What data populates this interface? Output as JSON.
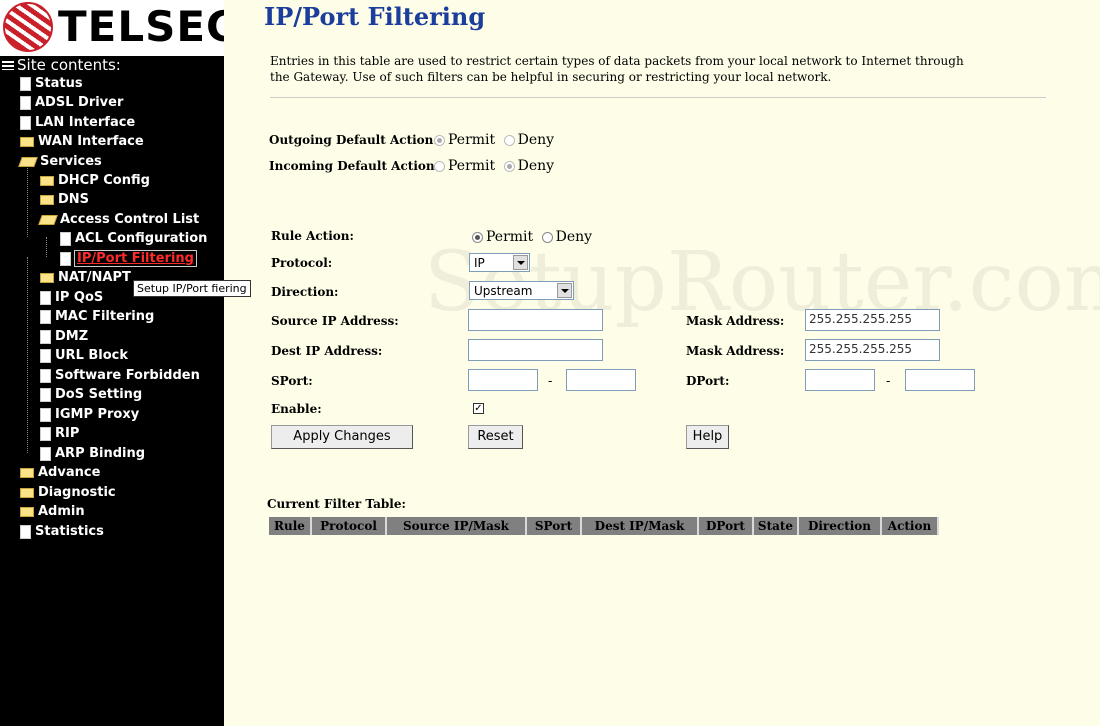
{
  "brand": {
    "logo_text": "TELSEC"
  },
  "sidebar": {
    "heading": "Site contents:",
    "items": [
      {
        "label": "Status",
        "icon": "doc"
      },
      {
        "label": "ADSL Driver",
        "icon": "doc"
      },
      {
        "label": "LAN Interface",
        "icon": "doc"
      },
      {
        "label": "WAN Interface",
        "icon": "folder"
      },
      {
        "label": "Services",
        "icon": "folder-open"
      },
      {
        "label": "DHCP Config",
        "icon": "folder"
      },
      {
        "label": "DNS",
        "icon": "folder"
      },
      {
        "label": "Access Control List",
        "icon": "folder-open"
      },
      {
        "label": "ACL Configuration",
        "icon": "doc"
      },
      {
        "label": "IP/Port Filtering",
        "icon": "doc",
        "selected": true
      },
      {
        "label": "NAT/NAPT",
        "icon": "folder"
      },
      {
        "label": "IP QoS",
        "icon": "doc"
      },
      {
        "label": "MAC Filtering",
        "icon": "doc"
      },
      {
        "label": "DMZ",
        "icon": "doc"
      },
      {
        "label": "URL Block",
        "icon": "doc"
      },
      {
        "label": "Software Forbidden",
        "icon": "doc"
      },
      {
        "label": "DoS Setting",
        "icon": "doc"
      },
      {
        "label": "IGMP Proxy",
        "icon": "doc"
      },
      {
        "label": "RIP",
        "icon": "doc"
      },
      {
        "label": "ARP Binding",
        "icon": "doc"
      },
      {
        "label": "Advance",
        "icon": "folder"
      },
      {
        "label": "Diagnostic",
        "icon": "folder"
      },
      {
        "label": "Admin",
        "icon": "folder"
      },
      {
        "label": "Statistics",
        "icon": "doc"
      }
    ],
    "tooltip": "Setup IP/Port fiering"
  },
  "page": {
    "title": "IP/Port Filtering",
    "description": "Entries in this table are used to restrict certain types of data packets from your local network to Internet through the Gateway. Use of such filters can be helpful in securing or restricting your local network."
  },
  "defaults": {
    "outgoing_label": "Outgoing Default Action:",
    "incoming_label": "Incoming Default Action:",
    "permit": "Permit",
    "deny": "Deny",
    "outgoing_value": "Permit",
    "incoming_value": "Deny"
  },
  "form": {
    "rule_action_label": "Rule Action:",
    "rule_action_value": "Permit",
    "protocol_label": "Protocol:",
    "protocol_value": "IP",
    "direction_label": "Direction:",
    "direction_value": "Upstream",
    "source_ip_label": "Source IP Address:",
    "source_ip_value": "",
    "dest_ip_label": "Dest IP Address:",
    "dest_ip_value": "",
    "mask_label": "Mask Address:",
    "source_mask_value": "255.255.255.255",
    "dest_mask_value": "255.255.255.255",
    "sport_label": "SPort:",
    "dport_label": "DPort:",
    "range_sep": "-",
    "enable_label": "Enable:",
    "enable_checked": true,
    "checkmark": "✓",
    "apply_label": "Apply Changes",
    "reset_label": "Reset",
    "help_label": "Help"
  },
  "table": {
    "title": "Current Filter Table:",
    "columns": [
      "Rule",
      "Protocol",
      "Source IP/Mask",
      "SPort",
      "Dest IP/Mask",
      "DPort",
      "State",
      "Direction",
      "Action"
    ],
    "rows": []
  },
  "watermark": "SetupRouter.com",
  "colors": {
    "title": "#1b3d9c",
    "background": "#fefde8",
    "sidebar": "#000000",
    "selected": "#ff2a2a",
    "table_header": "#808080"
  }
}
